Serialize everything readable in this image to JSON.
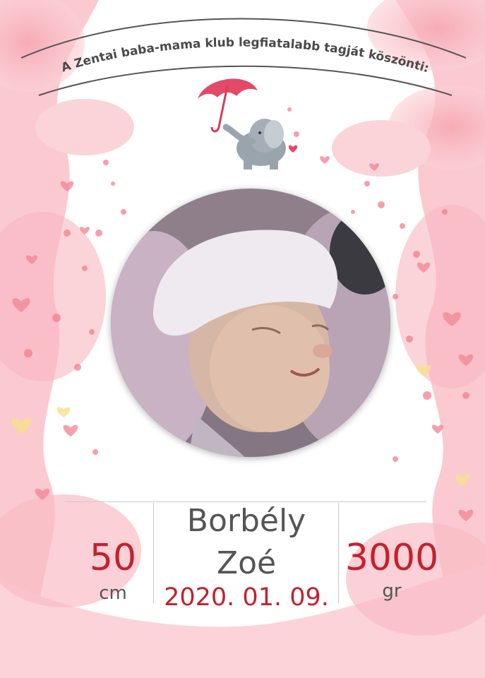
{
  "banner": {
    "text": "A Zentai baba-mama klub legfiatalabb tagját köszönti:"
  },
  "baby": {
    "first_name_line": "Borbély",
    "second_name_line": "Zoé",
    "date": "2020. 01. 09."
  },
  "length": {
    "value": "50",
    "unit": "cm"
  },
  "weight": {
    "value": "3000",
    "unit": "gr"
  },
  "colors": {
    "accent": "#c5202e",
    "text": "#555555",
    "pink": "#f8b6bf"
  },
  "icons": [
    "umbrella-icon",
    "elephant-icon",
    "heart-icon"
  ]
}
